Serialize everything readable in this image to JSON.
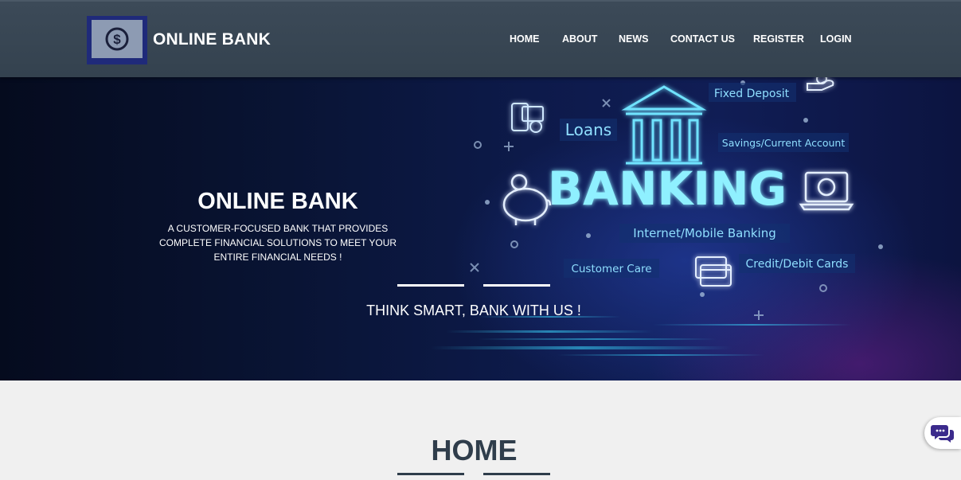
{
  "header": {
    "brand": "ONLINE BANK",
    "nav": [
      "HOME",
      "ABOUT",
      "NEWS",
      "CONTACT US",
      "REGISTER",
      "LOGIN"
    ]
  },
  "hero": {
    "title": "ONLINE BANK",
    "subtitle": "A CUSTOMER-FOCUSED BANK THAT PROVIDES COMPLETE FINANCIAL SOLUTIONS TO MEET YOUR ENTIRE FINANCIAL NEEDS !",
    "slogan": "THINK SMART, BANK WITH US !",
    "graphic_labels": {
      "main": "BANKING",
      "fixed_deposit": "Fixed Deposit",
      "loans": "Loans",
      "savings": "Savings/Current Account",
      "internet": "Internet/Mobile Banking",
      "customer_care": "Customer Care",
      "cards": "Credit/Debit Cards"
    }
  },
  "section": {
    "title": "HOME"
  },
  "colors": {
    "header_bg": "#36444f",
    "logo_bg": "#1f2a7a",
    "hero_bg": "#0b1640",
    "neon": "#7fe9ff",
    "section_text": "#2f3d4b",
    "page_bg": "#f0f0f0",
    "chat_icon": "#3b2a8c"
  },
  "icons": [
    "dollar-monitor-icon",
    "bank-building-icon",
    "piggy-bank-icon",
    "phone-payment-icon",
    "laptop-dollar-icon",
    "credit-card-icon",
    "hand-coin-icon",
    "chat-bubbles-icon"
  ]
}
